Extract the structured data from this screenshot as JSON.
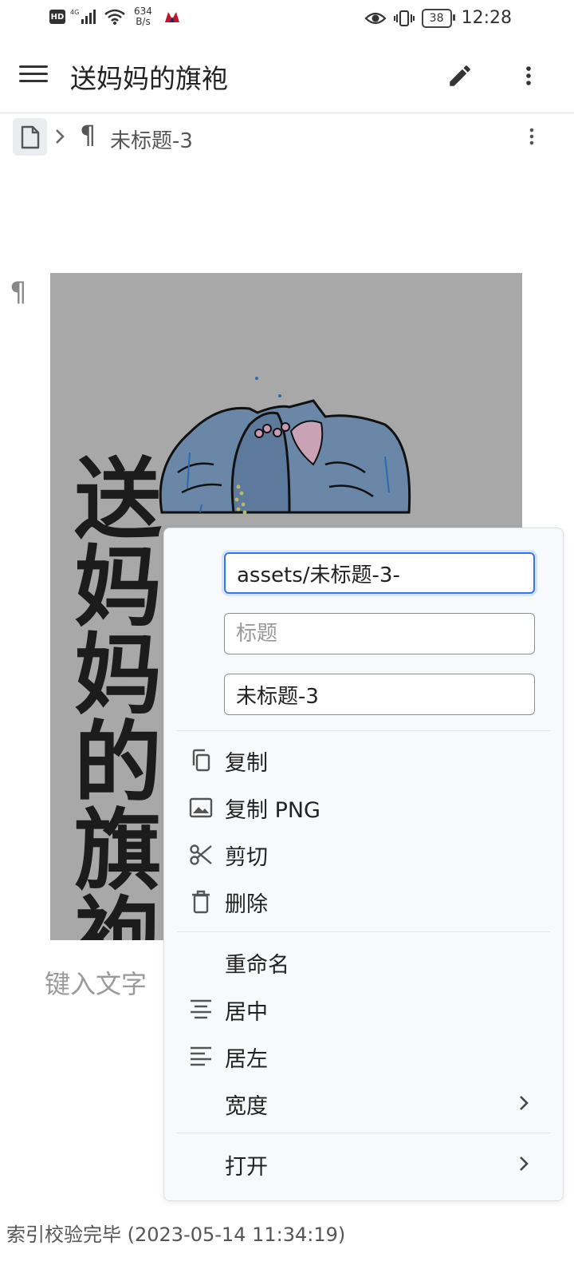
{
  "status_bar": {
    "hd": "HD",
    "net_type": "4G",
    "speed_value": "634",
    "speed_unit": "B/s",
    "battery": "38",
    "time": "12:28"
  },
  "app_bar": {
    "title": "送妈妈的旗袍"
  },
  "breadcrumb": {
    "block_label": "未标题-3"
  },
  "editor": {
    "image_caption_art": "送妈妈的旗袍",
    "placeholder": "键入文字"
  },
  "context_menu": {
    "path_value": "assets/未标题-3-",
    "title_placeholder": "标题",
    "name_value": "未标题-3",
    "items": {
      "copy": "复制",
      "copy_png": "复制 PNG",
      "cut": "剪切",
      "delete": "删除",
      "rename": "重命名",
      "center": "居中",
      "left": "居左",
      "width": "宽度",
      "open": "打开"
    }
  },
  "footer": {
    "status": "索引校验完毕 (2023-05-14 11:34:19)"
  },
  "colors": {
    "accent": "#3575f0",
    "image_bg": "#a8a8a8",
    "menu_bg": "#f8f9fa"
  }
}
